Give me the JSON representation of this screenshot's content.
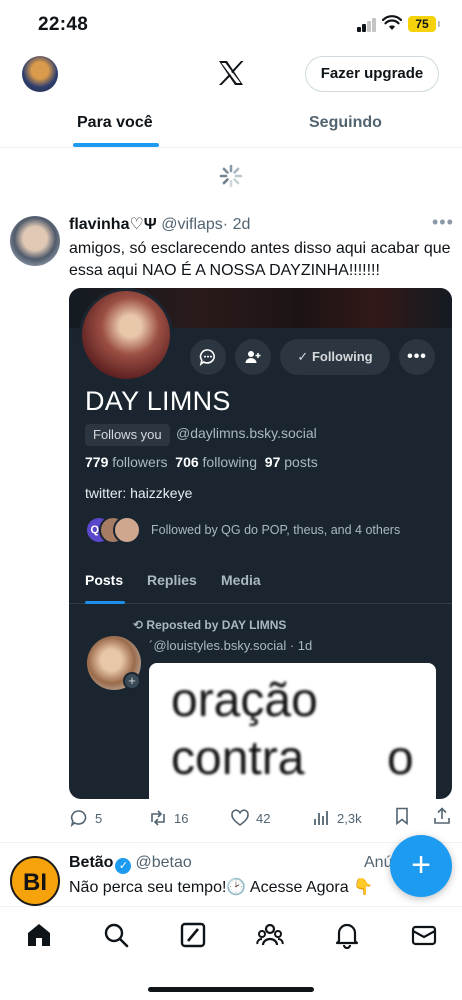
{
  "status_bar": {
    "time": "22:48",
    "battery": "75"
  },
  "header": {
    "upgrade_label": "Fazer upgrade"
  },
  "tabs": [
    {
      "label": "Para você"
    },
    {
      "label": "Seguindo"
    }
  ],
  "tweet": {
    "name": "flavinha♡Ψ",
    "handle": "@viflaps",
    "time": "· 2d",
    "text": "amigos, só esclarecendo antes disso aqui acabar que essa aqui NAO É A NOSSA DAYZINHA!!!!!!!",
    "card": {
      "following_label": "Following",
      "display_name": "DAY LIMNS",
      "follows_you": "Follows you",
      "handle": "@daylimns.bsky.social",
      "followers_count": "779",
      "followers_label": "followers",
      "following_count": "706",
      "following_word": "following",
      "posts_count": "97",
      "posts_label": "posts",
      "bio": "twitter: haizzkeye",
      "followed_by": "Followed by QG do POP, theus, and 4 others",
      "tabs": [
        "Posts",
        "Replies",
        "Media"
      ],
      "repost_line": "Reposted by DAY LIMNS",
      "inner_handle": "´@louistyles.bsky.social · 1d",
      "inner_text_1": "oração",
      "inner_text_2": "contra",
      "inner_text_3": "o"
    },
    "actions": {
      "replies": "5",
      "reposts": "16",
      "likes": "42",
      "views": "2,3k"
    }
  },
  "tweet2": {
    "avatar_text": "BI",
    "name": "Betão",
    "handle": "@betao",
    "right_label": "Anú",
    "text": "Não perca seu tempo!🕑 Acesse Agora 👇"
  },
  "fab_label": "+"
}
